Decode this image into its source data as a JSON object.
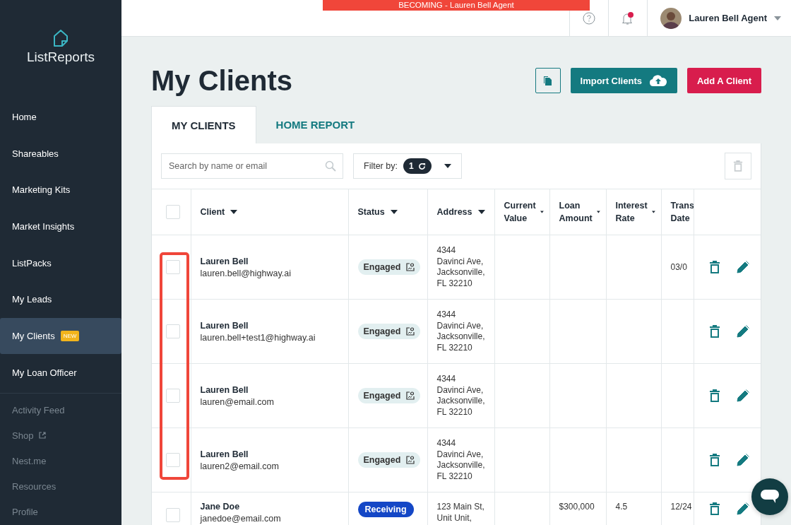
{
  "sidebar": {
    "logo": "ListReports",
    "items": [
      {
        "label": "Home",
        "kind": "main",
        "selected": false
      },
      {
        "label": "Shareables",
        "kind": "main",
        "selected": false
      },
      {
        "label": "Marketing Kits",
        "kind": "main",
        "selected": false
      },
      {
        "label": "Market Insights",
        "kind": "main",
        "selected": false
      },
      {
        "label": "ListPacks",
        "kind": "main",
        "selected": false
      },
      {
        "label": "My Leads",
        "kind": "main",
        "selected": false
      },
      {
        "label": "My Clients",
        "kind": "main",
        "selected": true,
        "badge": "NEW"
      },
      {
        "label": "My Loan Officer",
        "kind": "main",
        "selected": false
      },
      {
        "label": "Activity Feed",
        "kind": "minor",
        "selected": false
      },
      {
        "label": "Shop",
        "kind": "minor",
        "selected": false,
        "external": true
      },
      {
        "label": "Nest.me",
        "kind": "minor",
        "selected": false
      },
      {
        "label": "Resources",
        "kind": "minor",
        "selected": false
      },
      {
        "label": "Profile",
        "kind": "minor",
        "selected": false
      }
    ]
  },
  "banner": "BECOMING - Lauren Bell Agent",
  "topbar": {
    "user": "Lauren Bell Agent",
    "has_notification": true
  },
  "page": {
    "title": "My Clients",
    "buttons": [
      {
        "label": "Import Clients",
        "kind": "import"
      },
      {
        "label": "Add A Client",
        "kind": "add"
      }
    ]
  },
  "tabs": [
    {
      "label": "MY CLIENTS",
      "selected": true
    },
    {
      "label": "HOME REPORT",
      "selected": false
    }
  ],
  "search": {
    "placeholder": "Search by name or email"
  },
  "filter": {
    "label": "Filter by:",
    "count": "1"
  },
  "table": {
    "select_all_checked": false,
    "columns": [
      {
        "lines": [
          "Client"
        ]
      },
      {
        "lines": [
          "Status"
        ]
      },
      {
        "lines": [
          "Address"
        ]
      },
      {
        "lines": [
          "Current",
          "Value"
        ]
      },
      {
        "lines": [
          "Loan",
          "Amount"
        ]
      },
      {
        "lines": [
          "Interest",
          "Rate"
        ]
      },
      {
        "lines": [
          "Trans",
          "Date"
        ]
      }
    ],
    "rows": [
      {
        "checked": false,
        "name": "Lauren Bell",
        "email": "lauren.bell@highway.ai",
        "status": {
          "label": "Engaged",
          "kind": "engaged"
        },
        "address_lines": [
          "4344",
          "Davinci Ave,",
          "Jacksonville,",
          "FL 32210"
        ],
        "trans_date": "03/0"
      },
      {
        "checked": false,
        "name": "Lauren Bell",
        "email": "lauren.bell+test1@highway.ai",
        "status": {
          "label": "Engaged",
          "kind": "engaged"
        },
        "address_lines": [
          "4344",
          "Davinci Ave,",
          "Jacksonville,",
          "FL 32210"
        ]
      },
      {
        "checked": false,
        "name": "Lauren Bell",
        "email": "lauren@email.com",
        "status": {
          "label": "Engaged",
          "kind": "engaged"
        },
        "address_lines": [
          "4344",
          "Davinci Ave,",
          "Jacksonville,",
          "FL 32210"
        ]
      },
      {
        "checked": false,
        "name": "Lauren Bell",
        "email": "lauren2@email.com",
        "status": {
          "label": "Engaged",
          "kind": "engaged"
        },
        "address_lines": [
          "4344",
          "Davinci Ave,",
          "Jacksonville,",
          "FL 32210"
        ]
      },
      {
        "checked": false,
        "name": "Jane Doe",
        "email": "janedoe@email.com",
        "status": {
          "label": "Receiving",
          "kind": "receiving"
        },
        "address_lines": [
          "123 Main St,",
          "Unit Unit,"
        ],
        "loan_amount": "$300,000",
        "interest_rate": "4.5",
        "trans_date": "12/24"
      }
    ]
  }
}
